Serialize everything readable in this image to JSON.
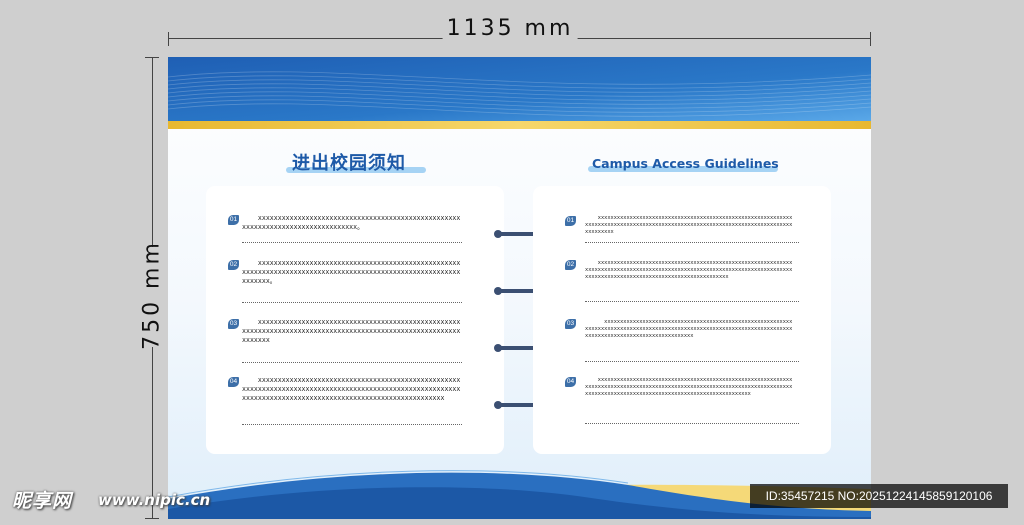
{
  "dimensions": {
    "width_label": "1135 mm",
    "height_label": "750 mm"
  },
  "board": {
    "title_zh": "进出校园须知",
    "title_en": "Campus Access Guidelines",
    "colors": {
      "primary_blue": "#1e5aa8",
      "gold": "#f2c94c",
      "ring": "#3b4f72",
      "number_badge": "#3d6fa8"
    },
    "left_items": [
      {
        "num": "01",
        "text": "    xxxxxxxxxxxxxxxxxxxxxxxxxxxxxxxxxxxxxxxxxxxxxxxxxxxxxxxxxxxxxxxxxxxxxxxxxxxxxxxx。"
      },
      {
        "num": "02",
        "text": "    xxxxxxxxxxxxxxxxxxxxxxxxxxxxxxxxxxxxxxxxxxxxxxxxxxxxxxxxxxxxxxxxxxxxxxxxxxxxxxxxxxxxxxxxxxxxxxxxxxxxxxxxxxxxxxxxx。"
      },
      {
        "num": "03",
        "text": "    xxxxxxxxxxxxxxxxxxxxxxxxxxxxxxxxxxxxxxxxxxxxxxxxxxxxxxxxxxxxxxxxxxxxxxxxxxxxxxxxxxxxxxxxxxxxxxxxxxxxxxxxxxxxxxxxx"
      },
      {
        "num": "04",
        "text": "    xxxxxxxxxxxxxxxxxxxxxxxxxxxxxxxxxxxxxxxxxxxxxxxxxxxxxxxxxxxxxxxxxxxxxxxxxxxxxxxxxxxxxxxxxxxxxxxxxxxxxxxxxxxxxxxxxxxxxxxxxxxxxxxxxxxxxxxxxxxxxxxxxxxxxxxxxxxxx"
      }
    ],
    "right_items": [
      {
        "num": "01",
        "text": "    xxxxxxxxxxxxxxxxxxxxxxxxxxxxxxxxxxxxxxxxxxxxxxxxxxxxxxxxxxxxxxxxxxxxxxxxxxxxxxxxxxxxxxxxxxxxxxxxxxxxxxxxxxxxxxxxxxxxxxxxxxxxxxxxxxxxxxx"
      },
      {
        "num": "02",
        "text": "    xxxxxxxxxxxxxxxxxxxxxxxxxxxxxxxxxxxxxxxxxxxxxxxxxxxxxxxxxxxxxxxxxxxxxxxxxxxxxxxxxxxxxxxxxxxxxxxxxxxxxxxxxxxxxxxxxxxxxxxxxxxxxxxxxxxxxxxxxxxxxxxxxxxxxxxxxxxxxxxxxxxxxxxxxxx"
      },
      {
        "num": "03",
        "text": "      xxxxxxxxxxxxxxxxxxxxxxxxxxxxxxxxxxxxxxxxxxxxxxxxxxxxxxxxxxxxxxxxxxxxxxxxxxxxxxxxxxxxxxxxxxxxxxxxxxxxxxxxxxxxxxxxxxxxxxxxxxxxxxxxxxxxxxxxxxxxxxxxxxxxxxxxxxxxxx"
      },
      {
        "num": "04",
        "text": "    xxxxxxxxxxxxxxxxxxxxxxxxxxxxxxxxxxxxxxxxxxxxxxxxxxxxxxxxxxxxxxxxxxxxxxxxxxxxxxxxxxxxxxxxxxxxxxxxxxxxxxxxxxxxxxxxxxxxxxxxxxxxxxxxxxxxxxxxxxxxxxxxxxxxxxxxxxxxxxxxxxxxxxxxxxxxxxxxxx"
      }
    ]
  },
  "watermark": {
    "logo": "昵享网",
    "url": "www.nipic.cn",
    "id_text": "ID:35457215 NO:20251224145859120106"
  }
}
